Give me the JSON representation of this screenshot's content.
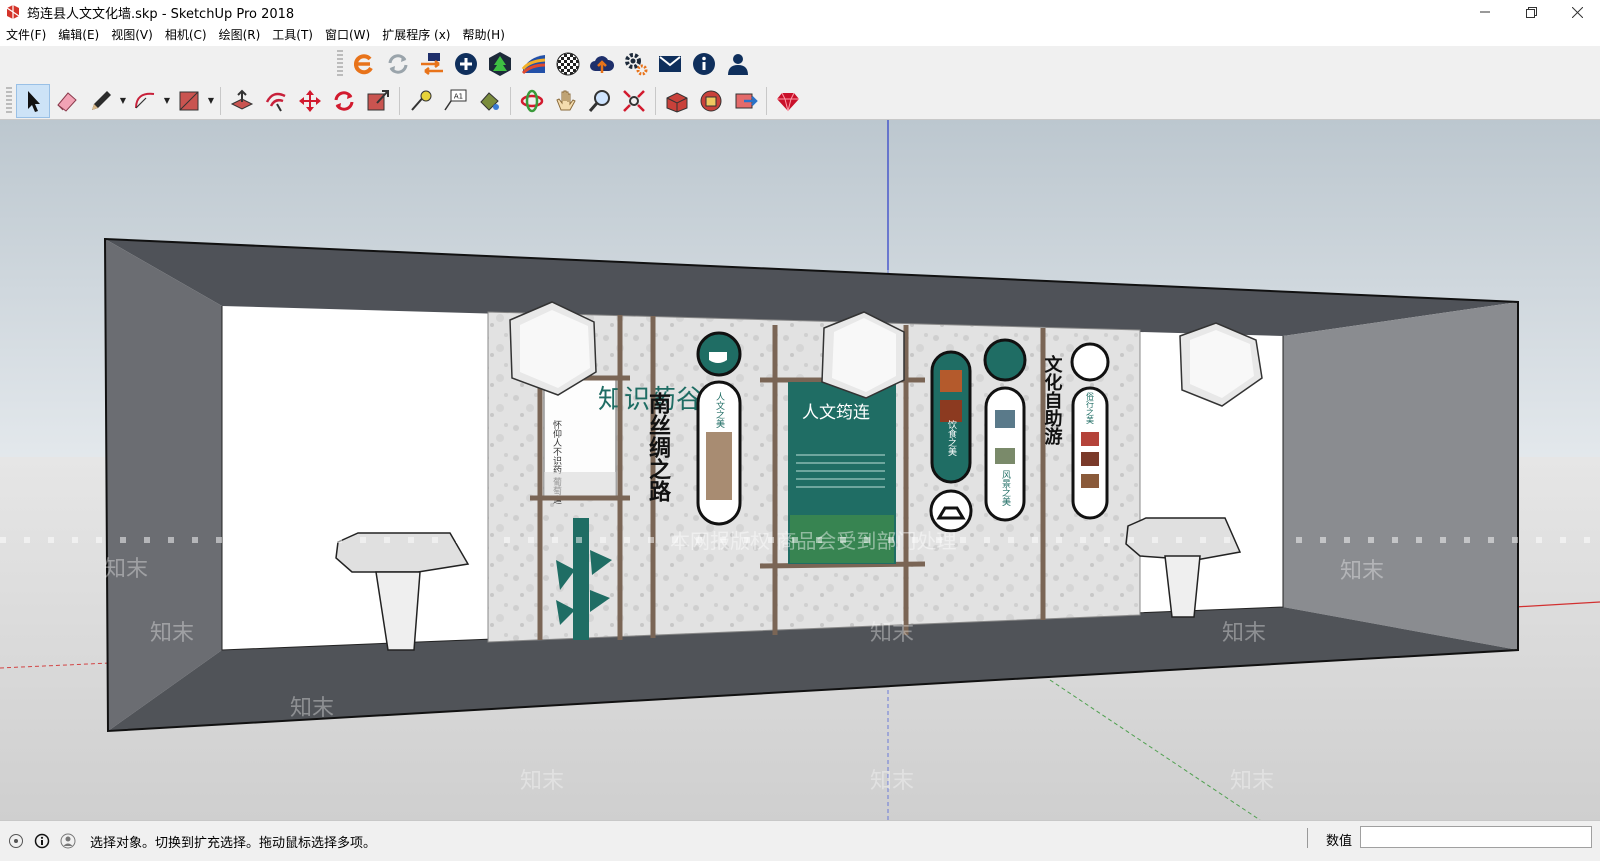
{
  "window": {
    "title": "筠连县人文文化墙.skp - SketchUp Pro 2018"
  },
  "menu": [
    "文件(F)",
    "编辑(E)",
    "视图(V)",
    "相机(C)",
    "绘图(R)",
    "工具(T)",
    "窗口(W)",
    "扩展程序 (x)",
    "帮助(H)"
  ],
  "scene": {
    "left_board": "知识药谷",
    "left_board_text": "怀仰人不识药 葡萄道",
    "silk_road": "南丝绸之路",
    "panel1_text": "人文之美",
    "center_title": "人文筠连",
    "panel3_text": "饮食之美",
    "panel4_text": "风景之美",
    "culture_text": "文化自助游",
    "panel5_text": "俗行之美",
    "watermark": "知末",
    "center_watermark": "本网报版权 商品会受到部门处理"
  },
  "status": {
    "hint": "选择对象。切换到扩充选择。拖动鼠标选择多项。",
    "measure_label": "数值"
  },
  "colors": {
    "accent": "#1f6d64",
    "selection": "#cde3f7"
  }
}
